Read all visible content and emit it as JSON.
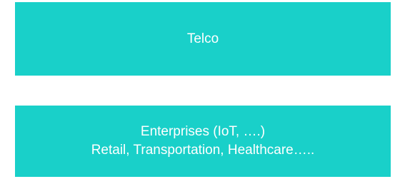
{
  "colors": {
    "block_fill": "#19d0c9",
    "text": "#ffffff",
    "background": "#ffffff"
  },
  "blocks": [
    {
      "lines": [
        "Telco"
      ]
    },
    {
      "lines": [
        "Enterprises (IoT, ….)",
        "Retail, Transportation, Healthcare….."
      ]
    }
  ]
}
